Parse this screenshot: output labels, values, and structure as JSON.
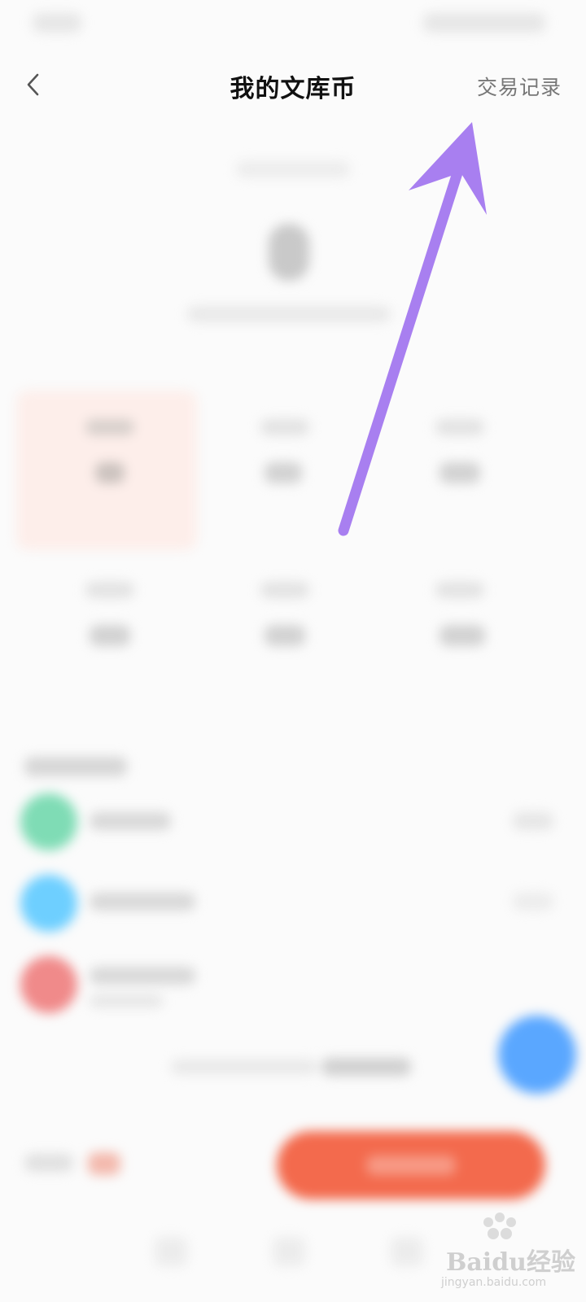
{
  "header": {
    "title": "我的文库币",
    "trade_record": "交易记录"
  },
  "colors": {
    "accent_purple": "#a87ff0",
    "orange_button": "#f36a4d",
    "fab_blue": "#5aa7ff",
    "green_icon": "#7fdcb5",
    "blue_icon": "#6ecfff",
    "red_icon": "#f08a8a"
  },
  "icons": {
    "back": "chevron-left-icon",
    "annotation": "arrow-annotation"
  },
  "watermark": {
    "brand": "Baidu经验",
    "url": "jingyan.baidu.com"
  }
}
